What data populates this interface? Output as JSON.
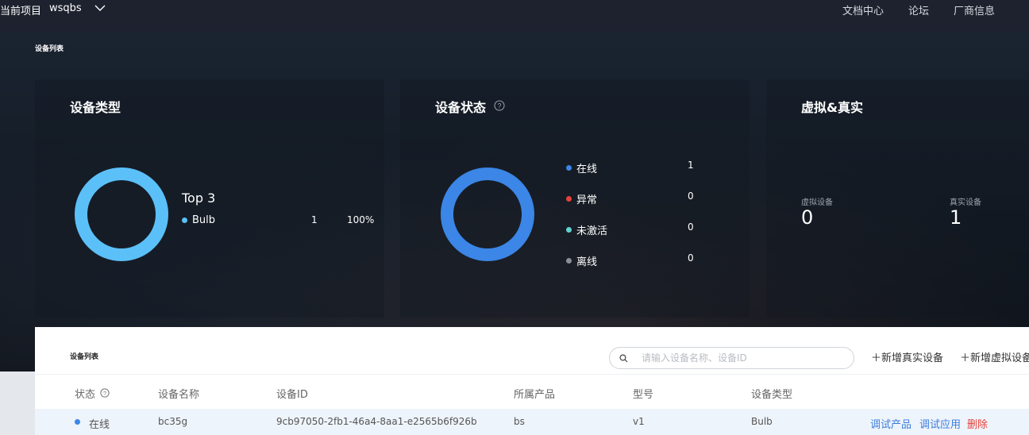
{
  "topbar": {
    "project_label": "当前项目",
    "project_name": "wsqbs",
    "nav": [
      "文档中心",
      "论坛",
      "厂商信息"
    ]
  },
  "hero": {
    "breadcrumb": "设备列表",
    "type_card": {
      "title": "设备类型",
      "top_label": "Top 3",
      "items": [
        {
          "name": "Bulb",
          "count": "1",
          "pct": "100%",
          "color": "#5bc0f8"
        }
      ]
    },
    "status_card": {
      "title": "设备状态",
      "items": [
        {
          "name": "在线",
          "count": "1",
          "color": "#3b86e6"
        },
        {
          "name": "异常",
          "count": "0",
          "color": "#e8403b"
        },
        {
          "name": "未激活",
          "count": "0",
          "color": "#5fd3d0"
        },
        {
          "name": "离线",
          "count": "0",
          "color": "#8a8f96"
        }
      ]
    },
    "vr_card": {
      "title": "虚拟&真实",
      "virtual_label": "虚拟设备",
      "virtual_value": "0",
      "real_label": "真实设备",
      "real_value": "1"
    }
  },
  "list": {
    "title": "设备列表",
    "search_placeholder": "请输入设备名称、设备ID",
    "add_real": "＋新增真实设备",
    "add_virtual": "＋新增虚拟设备",
    "columns": [
      "状态",
      "设备名称",
      "设备ID",
      "所属产品",
      "型号",
      "设备类型"
    ],
    "rows": [
      {
        "status": "在线",
        "status_color": "#3b86e6",
        "name": "bc35g",
        "id": "9cb97050-2fb1-46a4-8aa1-e2565b6f926b",
        "product": "bs",
        "model": "v1",
        "type": "Bulb",
        "actions": [
          "调试产品",
          "调试应用",
          "删除"
        ]
      }
    ]
  }
}
